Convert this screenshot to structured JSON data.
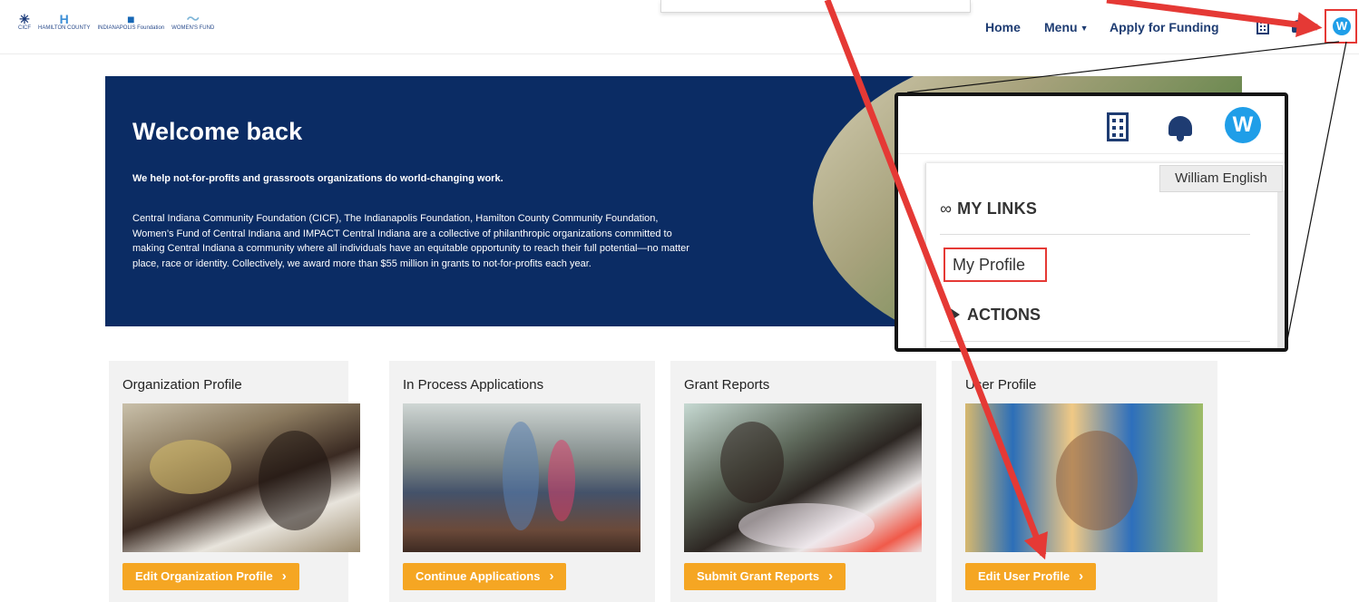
{
  "header": {
    "logos": [
      {
        "name": "cicf-logo",
        "text": "CICF"
      },
      {
        "name": "hamilton-county-logo",
        "text": "HAMILTON COUNTY"
      },
      {
        "name": "indianapolis-foundation-logo",
        "text": "INDIANAPOLIS Foundation"
      },
      {
        "name": "womens-fund-logo",
        "text": "WOMEN'S FUND"
      }
    ],
    "nav": {
      "home": "Home",
      "menu": "Menu",
      "apply": "Apply for Funding"
    },
    "avatar_initial": "W",
    "icons": [
      "building-icon",
      "bell-icon",
      "user-avatar-icon",
      "chevron-down-icon"
    ]
  },
  "hero": {
    "title": "Welcome back",
    "tagline": "We help not-for-profits and grassroots organizations do world-changing work.",
    "body": "Central Indiana Community Foundation (CICF), The Indianapolis Foundation, Hamilton County Community Foundation, Women’s Fund of Central Indiana and IMPACT Central Indiana are a collective of philanthropic organizations committed to making Central Indiana a community where all individuals have an equitable opportunity to reach their full potential—no matter place, race or identity. Collectively, we award more than $55 million in grants to not-for-profits each year."
  },
  "zoom_callout": {
    "avatar_initial": "W",
    "tooltip": "William English",
    "links_heading": "MY LINKS",
    "my_profile": "My Profile",
    "actions_heading": "ACTIONS"
  },
  "cards": [
    {
      "title": "Organization Profile",
      "button": "Edit Organization Profile"
    },
    {
      "title": "In Process Applications",
      "button": "Continue Applications"
    },
    {
      "title": "Grant Reports",
      "button": "Submit Grant Reports"
    },
    {
      "title": "User Profile",
      "button": "Edit User Profile"
    }
  ],
  "colors": {
    "hero_bg": "#0b2c64",
    "nav_text": "#1e3c72",
    "button_bg": "#f5a623",
    "avatar_bg": "#1f9ee8",
    "annotation_red": "#e53935"
  }
}
